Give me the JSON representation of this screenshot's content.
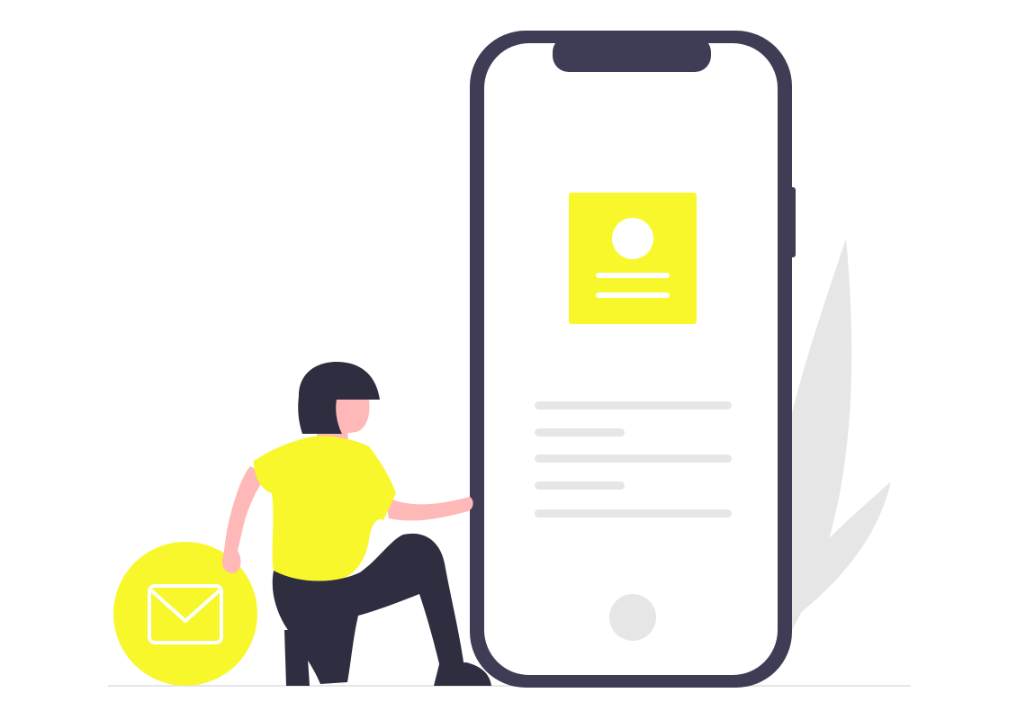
{
  "illustration": {
    "colors": {
      "accent": "#F7F72B",
      "phone_frame": "#3F3D56",
      "screen": "#FFFFFF",
      "placeholder_line": "#E6E6E6",
      "leaf": "#E6E6E6",
      "skin": "#FFB8B8",
      "hair": "#2F2E41",
      "pants": "#2F2E41",
      "ground": "#E6E6E6"
    },
    "icons": {
      "profile_card": "profile-card-icon",
      "avatar": "avatar-icon",
      "mail": "envelope-icon",
      "home_button": "home-button-icon"
    }
  }
}
